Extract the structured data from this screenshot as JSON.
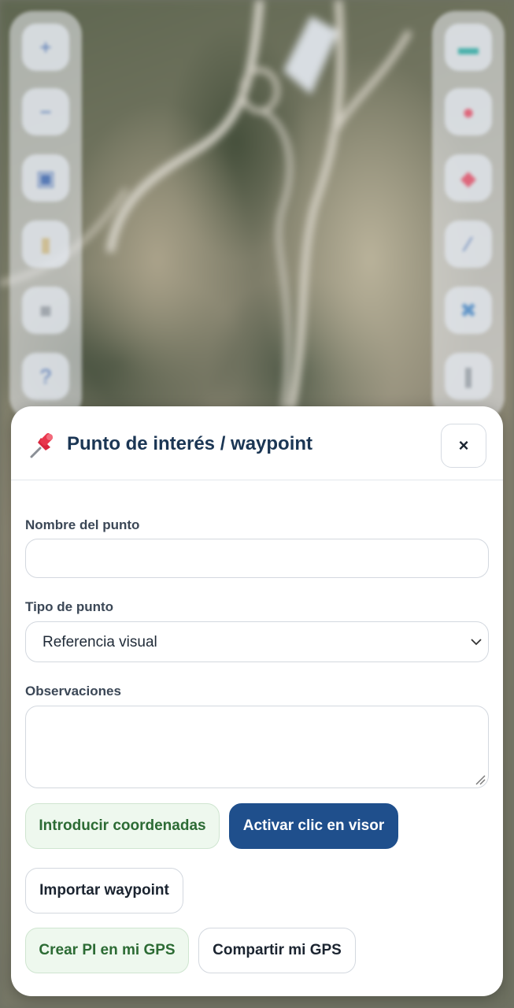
{
  "map": {
    "left_toolbar": [
      {
        "name": "zoom-in",
        "icon": "plus-icon",
        "glyph": "+"
      },
      {
        "name": "zoom-out",
        "icon": "minus-icon",
        "glyph": "−"
      },
      {
        "name": "layers",
        "icon": "map-app-icon",
        "glyph": "▣"
      },
      {
        "name": "save",
        "icon": "document-icon",
        "glyph": "▮"
      },
      {
        "name": "delete",
        "icon": "trash-icon",
        "glyph": "■"
      },
      {
        "name": "help",
        "icon": "question-icon",
        "glyph": "?"
      }
    ],
    "right_toolbar": [
      {
        "name": "ruler",
        "icon": "ruler-icon",
        "glyph": "▬"
      },
      {
        "name": "marker",
        "icon": "map-pin-icon",
        "glyph": "●"
      },
      {
        "name": "waypoint",
        "icon": "pushpin-icon",
        "glyph": "◆"
      },
      {
        "name": "line",
        "icon": "pen-icon",
        "glyph": "∕"
      },
      {
        "name": "network",
        "icon": "network-icon",
        "glyph": "✖"
      },
      {
        "name": "tracks",
        "icon": "footprints-icon",
        "glyph": "∥"
      }
    ]
  },
  "dialog": {
    "icon": "pushpin-icon",
    "title": "Punto de interés / waypoint",
    "close_label": "×",
    "name_label": "Nombre del punto",
    "name_value": "",
    "type_label": "Tipo de punto",
    "type_value": "Referencia visual",
    "notes_label": "Observaciones",
    "notes_value": "",
    "buttons": {
      "enter_coords": "Introducir coordenadas",
      "activate_click": "Activar clic en visor",
      "import_waypoint": "Importar waypoint",
      "create_gps": "Crear PI en mi GPS",
      "share_gps": "Compartir mi GPS"
    }
  },
  "colors": {
    "title": "#1b3654",
    "primary_button": "#1f4f8c",
    "green_button_text": "#2c6b34",
    "green_button_bg": "#eef8ee"
  }
}
